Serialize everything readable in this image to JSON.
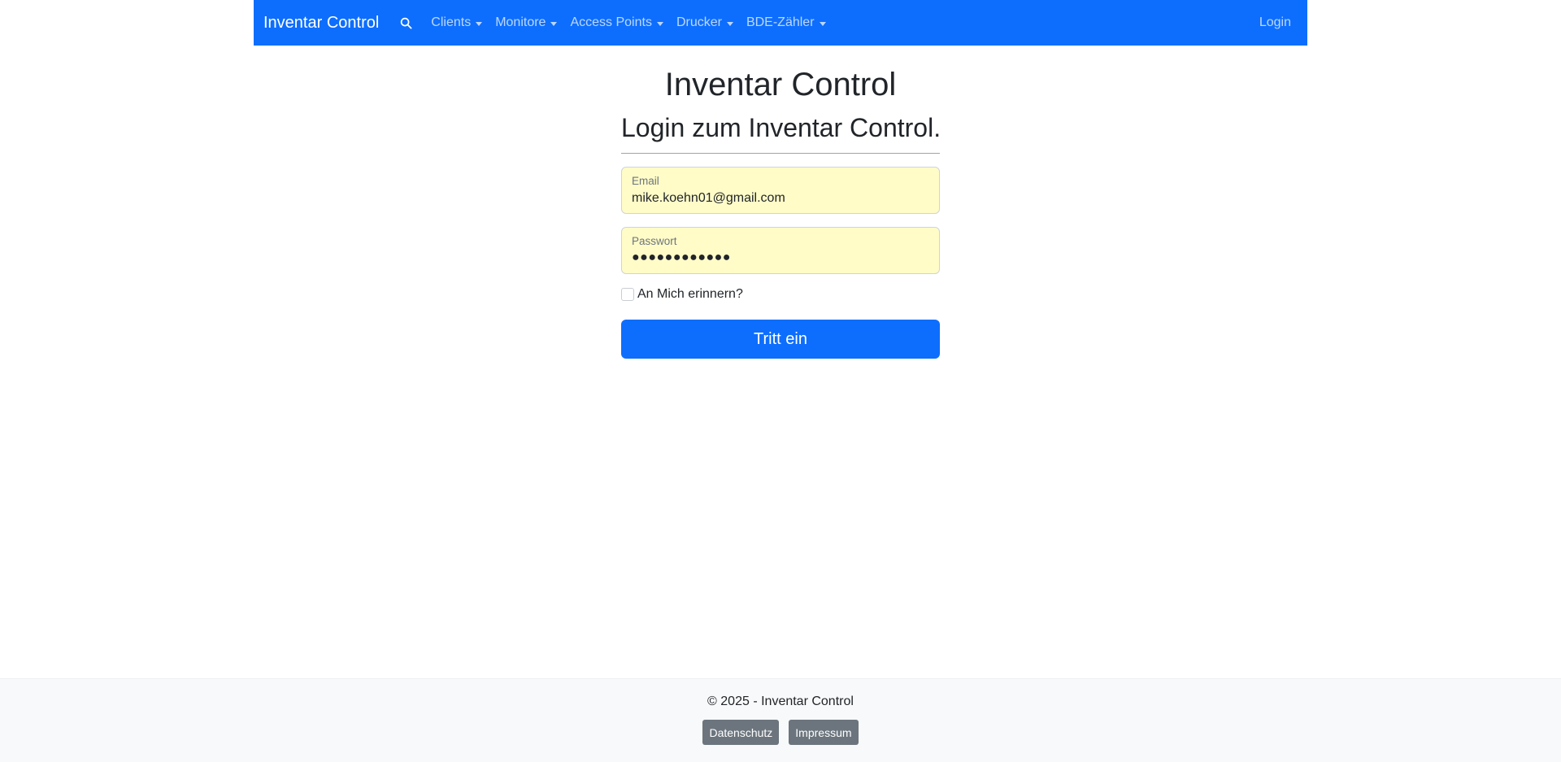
{
  "navbar": {
    "brand": "Inventar Control",
    "search_icon": "search-icon",
    "items": [
      {
        "label": "Clients"
      },
      {
        "label": "Monitore"
      },
      {
        "label": "Access Points"
      },
      {
        "label": "Drucker"
      },
      {
        "label": "BDE-Zähler"
      }
    ],
    "login": "Login",
    "background_color": "#0d6efd"
  },
  "main": {
    "title": "Inventar Control",
    "subtitle": "Login zum Inventar Control.",
    "email": {
      "label": "Email",
      "value": "mike.koehn01@gmail.com"
    },
    "password": {
      "label": "Passwort",
      "value": "●●●●●●●●●●●●"
    },
    "remember_label": "An Mich erinnern?",
    "remember_checked": false,
    "submit_label": "Tritt ein",
    "autofill_color": "#fffcc8"
  },
  "footer": {
    "copyright": "© 2025 - Inventar Control",
    "links": [
      {
        "label": "Datenschutz"
      },
      {
        "label": "Impressum"
      }
    ]
  }
}
